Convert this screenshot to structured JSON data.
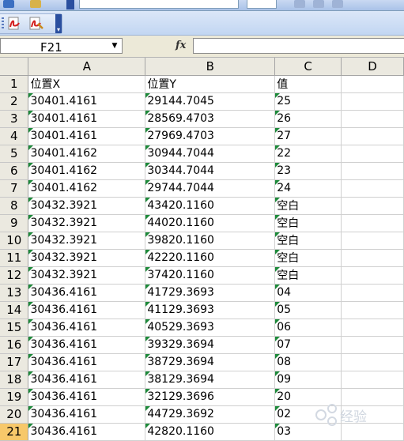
{
  "name_box": {
    "value": "F21"
  },
  "formula_bar": {
    "fx_label": "fx",
    "content": ""
  },
  "columns": [
    "A",
    "B",
    "C",
    "D"
  ],
  "rows": [
    {
      "n": "1",
      "a": "位置X",
      "b": "位置Y",
      "c": "值"
    },
    {
      "n": "2",
      "a": "30401.4161",
      "b": "29144.7045",
      "c": "25"
    },
    {
      "n": "3",
      "a": "30401.4161",
      "b": "28569.4703",
      "c": "26"
    },
    {
      "n": "4",
      "a": "30401.4161",
      "b": "27969.4703",
      "c": "27"
    },
    {
      "n": "5",
      "a": "30401.4162",
      "b": "30944.7044",
      "c": "22"
    },
    {
      "n": "6",
      "a": "30401.4162",
      "b": "30344.7044",
      "c": "23"
    },
    {
      "n": "7",
      "a": "30401.4162",
      "b": "29744.7044",
      "c": "24"
    },
    {
      "n": "8",
      "a": "30432.3921",
      "b": "43420.1160",
      "c": "空白"
    },
    {
      "n": "9",
      "a": "30432.3921",
      "b": "44020.1160",
      "c": "空白"
    },
    {
      "n": "10",
      "a": "30432.3921",
      "b": "39820.1160",
      "c": "空白"
    },
    {
      "n": "11",
      "a": "30432.3921",
      "b": "42220.1160",
      "c": "空白"
    },
    {
      "n": "12",
      "a": "30432.3921",
      "b": "37420.1160",
      "c": "空白"
    },
    {
      "n": "13",
      "a": "30436.4161",
      "b": "41729.3693",
      "c": "04"
    },
    {
      "n": "14",
      "a": "30436.4161",
      "b": "41129.3693",
      "c": "05"
    },
    {
      "n": "15",
      "a": "30436.4161",
      "b": "40529.3693",
      "c": "06"
    },
    {
      "n": "16",
      "a": "30436.4161",
      "b": "39329.3694",
      "c": "07"
    },
    {
      "n": "17",
      "a": "30436.4161",
      "b": "38729.3694",
      "c": "08"
    },
    {
      "n": "18",
      "a": "30436.4161",
      "b": "38129.3694",
      "c": "09"
    },
    {
      "n": "19",
      "a": "30436.4161",
      "b": "32129.3696",
      "c": "20"
    },
    {
      "n": "20",
      "a": "30436.4161",
      "b": "44729.3692",
      "c": "02"
    },
    {
      "n": "21",
      "a": "30436.4161",
      "b": "42820.1160",
      "c": "03"
    }
  ],
  "watermark": {
    "text": "经验"
  },
  "colors": {
    "selected_row_header": "#f7c86a",
    "error_indicator": "#1d8a3a",
    "toolbar": "#c2d6f2"
  },
  "icons": [
    "pdf-convert-icon",
    "pdf-options-icon",
    "toolbar-options-chevron-icon",
    "name-box-dropdown-icon",
    "insert-function-icon"
  ]
}
